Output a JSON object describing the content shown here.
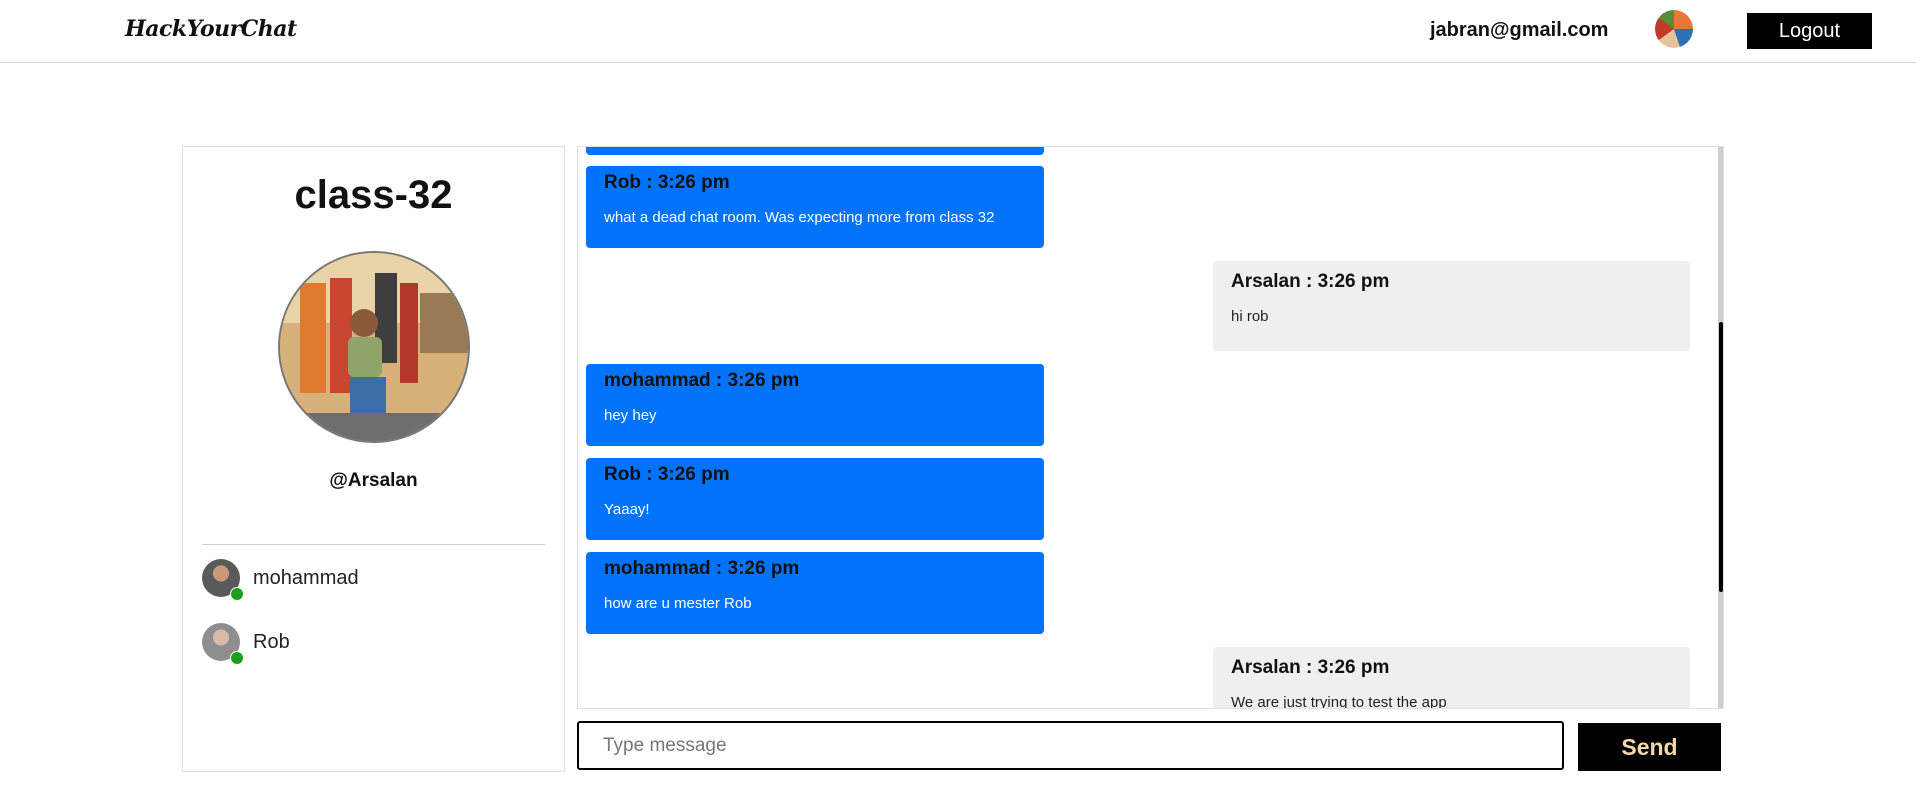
{
  "header": {
    "brand": "HackYourChat",
    "user_email": "jabran@gmail.com",
    "logout_label": "Logout"
  },
  "room": {
    "title": "class-32",
    "handle": "@Arsalan",
    "members": [
      {
        "name": "mohammad",
        "online": true
      },
      {
        "name": "Rob",
        "online": true
      }
    ]
  },
  "messages": [
    {
      "side": "other",
      "header": "",
      "text": ""
    },
    {
      "side": "other",
      "header": "Rob : 3:26 pm",
      "text": "what a dead chat room. Was expecting more from class 32"
    },
    {
      "side": "self",
      "header": "Arsalan : 3:26 pm",
      "text": "hi rob"
    },
    {
      "side": "other",
      "header": "mohammad : 3:26 pm",
      "text": "hey hey"
    },
    {
      "side": "other",
      "header": "Rob : 3:26 pm",
      "text": "Yaaay!"
    },
    {
      "side": "other",
      "header": "mohammad : 3:26 pm",
      "text": "how are u mester Rob"
    },
    {
      "side": "self",
      "header": "Arsalan : 3:26 pm",
      "text": "We are just trying to test the app"
    }
  ],
  "composer": {
    "placeholder": "Type message",
    "send_label": "Send"
  },
  "colors": {
    "other_bubble": "#0073fb",
    "self_bubble": "#efefef",
    "send_text": "#f4d8a8",
    "online": "#1f9d1f"
  }
}
